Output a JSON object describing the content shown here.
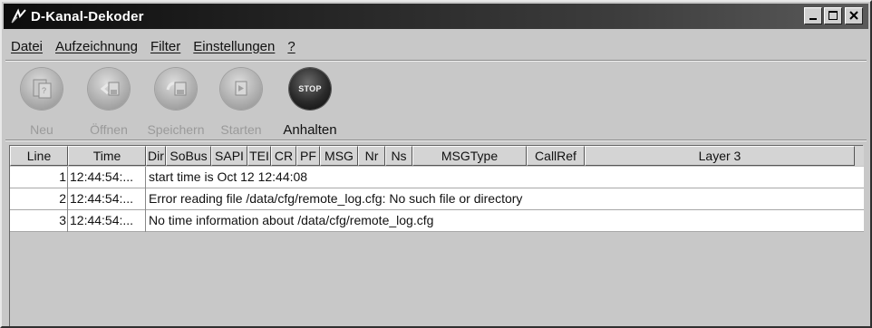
{
  "window": {
    "title": "D-Kanal-Dekoder"
  },
  "menu": [
    {
      "label": "Datei",
      "underline": true
    },
    {
      "label": "Aufzeichnung",
      "underline": true
    },
    {
      "label": "Filter",
      "underline": true
    },
    {
      "label": "Einstellungen",
      "underline": true
    },
    {
      "label": "?",
      "underline": true
    }
  ],
  "toolbar": {
    "new_label": "Neu",
    "open_label": "Öffnen",
    "save_label": "Speichern",
    "start_label": "Starten",
    "stop_label": "Anhalten",
    "stop_icon_text": "STOP"
  },
  "table": {
    "columns": [
      "Line",
      "Time",
      "Dir",
      "SoBus",
      "SAPI",
      "TEI",
      "CR",
      "PF",
      "MSG",
      "Nr",
      "Ns",
      "MSGType",
      "CallRef",
      "Layer 3"
    ],
    "rows": [
      {
        "line": "1",
        "time": "12:44:54:...",
        "text": "start time is Oct 12 12:44:08"
      },
      {
        "line": "2",
        "time": "12:44:54:...",
        "text": "Error reading file /data/cfg/remote_log.cfg: No such file or directory"
      },
      {
        "line": "3",
        "time": "12:44:54:...",
        "text": "No time information about /data/cfg/remote_log.cfg"
      }
    ]
  }
}
